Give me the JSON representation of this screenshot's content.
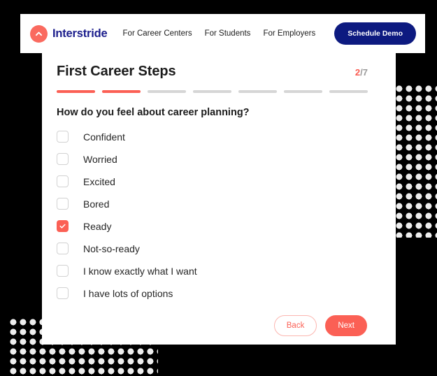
{
  "navbar": {
    "brand_name": "Interstride",
    "brand_icon": "chevron-up-circle-icon",
    "links": [
      {
        "label": "For Career Centers"
      },
      {
        "label": "For Students"
      },
      {
        "label": "For Employers"
      }
    ],
    "cta_label": "Schedule Demo",
    "cta_color": "#0d1a80"
  },
  "card": {
    "title": "First Career Steps",
    "step_current": "2",
    "step_total": "/7",
    "progress": {
      "total_segments": 7,
      "completed_segments": 2,
      "filled_color": "#fb6055",
      "empty_color": "#d6d6d6"
    },
    "question": "How do you feel about career planning?",
    "options": [
      {
        "label": "Confident",
        "checked": false
      },
      {
        "label": "Worried",
        "checked": false
      },
      {
        "label": "Excited",
        "checked": false
      },
      {
        "label": "Bored",
        "checked": false
      },
      {
        "label": "Ready",
        "checked": true
      },
      {
        "label": "Not-so-ready",
        "checked": false
      },
      {
        "label": "I know exactly what I want",
        "checked": false
      },
      {
        "label": "I have lots of options",
        "checked": false
      }
    ],
    "back_label": "Back",
    "next_label": "Next",
    "accent_color": "#fb6055"
  },
  "decoration": {
    "dot_color": "#ededed",
    "background_color": "#000000"
  }
}
